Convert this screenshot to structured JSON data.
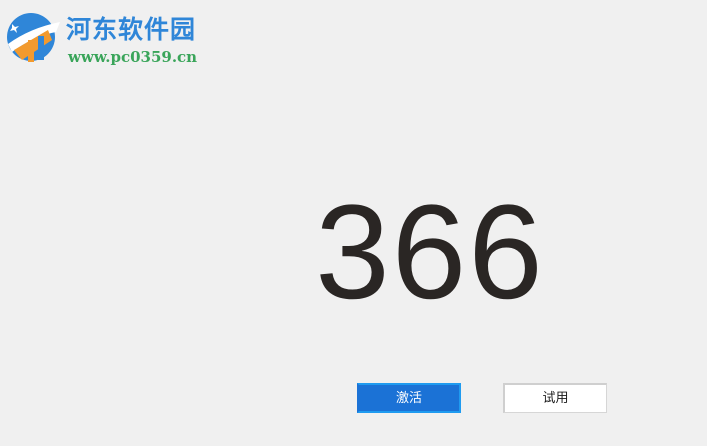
{
  "watermark": {
    "title": "河东软件园",
    "url": "www.pc0359.cn"
  },
  "counter": {
    "value": "366"
  },
  "buttons": {
    "activate_label": "激活",
    "trial_label": "试用"
  },
  "colors": {
    "background": "#f0f0f0",
    "activate_bg": "#1b72d6",
    "activate_border": "#1f9bf0",
    "counter_text": "#2a2624",
    "watermark_title": "#2f86d8",
    "watermark_url": "#3aa55a"
  }
}
